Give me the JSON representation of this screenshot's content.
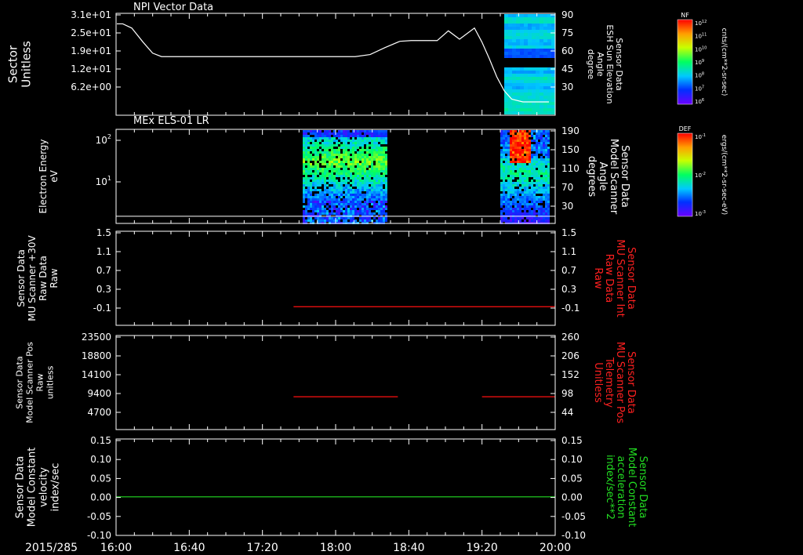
{
  "chart_data": [
    {
      "type": "heatmap",
      "title": "NPI Vector Data",
      "ylabel_left": [
        "Sector",
        "Unitless"
      ],
      "ylabel_right": [
        "Sensor Data",
        "ESH Sun Elevation",
        "Angle",
        "degree"
      ],
      "left_ticks": [
        "3.1e+01",
        "2.5e+01",
        "1.9e+01",
        "1.2e+01",
        "6.2e+00"
      ],
      "right_ticks": [
        "90",
        "75",
        "60",
        "45",
        "30"
      ],
      "right_range": [
        18,
        90
      ],
      "line_series": {
        "name": "ESH Sun Elevation Angle",
        "t": [
          0,
          8,
          20,
          35,
          48,
          60,
          80,
          110,
          130,
          148,
          155,
          162,
          170,
          178,
          185,
          190,
          197,
          202,
          208,
          215,
          222,
          232,
          240,
          248,
          256,
          262,
          268,
          276,
          285,
          300,
          320,
          340,
          360,
          380,
          395,
          405,
          420,
          430,
          445,
          460,
          480,
          490,
          500,
          510,
          520,
          530,
          545,
          560,
          570,
          580
        ],
        "values": [
          83,
          83,
          80,
          70,
          62,
          59.5,
          59.5,
          59.5,
          59.5,
          59.5,
          59.5,
          59.5,
          59.5,
          59.5,
          59.5,
          59.5,
          59.5,
          59.5,
          59.5,
          59.5,
          59.5,
          59.5,
          59.5,
          59.5,
          59.5,
          59.5,
          59.5,
          59.5,
          59.5,
          59.5,
          59.5,
          61,
          66,
          70.5,
          71,
          71,
          71,
          71,
          78,
          72,
          80,
          70,
          58,
          45,
          35,
          29,
          27,
          27,
          27,
          27
        ]
      },
      "colorbar": {
        "label": "NF",
        "unit": "cnts/(cm**2-sr-sec)",
        "ticks": [
          "10^12",
          "10^11",
          "10^10",
          "10^9",
          "10^8",
          "10^7",
          "10^6"
        ]
      }
    },
    {
      "type": "heatmap",
      "title": "MEx ELS-01 LR",
      "ylabel_left": [
        "Electron Energy",
        "eV"
      ],
      "ylabel_right": [
        "Sensor Data",
        "Model Scanner",
        "Angle",
        "degrees"
      ],
      "left_ticks": [
        "10^2",
        "10^1"
      ],
      "right_ticks": [
        "190",
        "150",
        "110",
        "70",
        "30"
      ],
      "right_range": [
        0,
        190
      ],
      "line_value": 5,
      "colorbar": {
        "label": "DEF",
        "unit": "ergs/(cm**2-sr-sec-eV)",
        "ticks": [
          "10^-1",
          "10^-2",
          "10^-3"
        ]
      }
    },
    {
      "type": "line",
      "ylabel_left": [
        "Sensor Data",
        "MU Scanner +30V",
        "Raw Data",
        "Raw"
      ],
      "ylabel_right": [
        "Sensor Data",
        "MU Scanner Int",
        "Raw Data",
        "Raw"
      ],
      "left_ticks": [
        "1.5",
        "1.1",
        "0.7",
        "0.3",
        "-0.1"
      ],
      "right_ticks": [
        "1.5",
        "1.1",
        "0.7",
        "0.3",
        "-0.1"
      ],
      "ylim": [
        -0.37,
        1.5
      ],
      "series": [
        {
          "color": "#ff1010",
          "segments": [
            [
              [
                97,
                0
              ],
              [
                240,
                0
              ]
            ]
          ]
        }
      ]
    },
    {
      "type": "line",
      "ylabel_left": [
        "Sensor Data",
        "Model Scanner Pos",
        "Raw",
        "unitless"
      ],
      "ylabel_right": [
        "Sensor Data",
        "MU Scanner Pos",
        "Telemetry",
        "Unitless"
      ],
      "left_ticks": [
        "23500",
        "18800",
        "14100",
        "9400",
        "4700"
      ],
      "right_ticks": [
        "260",
        "206",
        "152",
        "98",
        "44"
      ],
      "ylim": [
        0,
        23500
      ],
      "right_range": [
        0,
        260
      ],
      "series": [
        {
          "color": "#ff1010",
          "segments": [
            [
              [
                97,
                8200
              ],
              [
                154,
                8200
              ]
            ],
            [
              [
                200,
                8200
              ],
              [
                240,
                8200
              ]
            ]
          ]
        }
      ]
    },
    {
      "type": "line",
      "ylabel_left": [
        "Sensor Data",
        "Model Constant",
        "velocity",
        "index/sec"
      ],
      "ylabel_right": [
        "Sensor Data",
        "Model Constant",
        "acceleration",
        "index/sec**2"
      ],
      "left_ticks": [
        "0.15",
        "0.10",
        "0.05",
        "0.00",
        "-0.05",
        "-0.10"
      ],
      "right_ticks": [
        "0.15",
        "0.10",
        "0.05",
        "0.00",
        "-0.05",
        "-0.10"
      ],
      "ylim": [
        -0.1,
        0.15
      ],
      "series": [
        {
          "color": "#22dd22",
          "segments": [
            [
              [
                0,
                0
              ],
              [
                240,
                0
              ]
            ]
          ]
        }
      ]
    }
  ],
  "x_axis": {
    "date": "2015/285",
    "ticks": [
      "16:00",
      "16:40",
      "17:20",
      "18:00",
      "18:40",
      "19:20",
      "20:00"
    ],
    "range_minutes": [
      0,
      240
    ]
  }
}
